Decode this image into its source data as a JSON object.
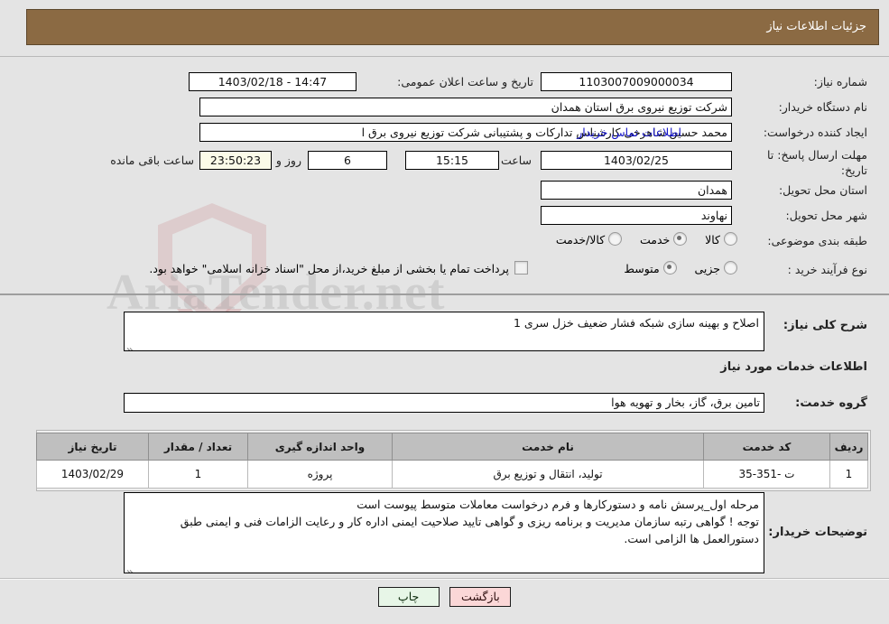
{
  "header": {
    "title": "جزئیات اطلاعات نیاز"
  },
  "details": {
    "need_number_label": "شماره نیاز:",
    "need_number_value": "1103007009000034",
    "announce_datetime_label": "تاریخ و ساعت اعلان عمومی:",
    "announce_datetime_value": "14:47 - 1403/02/18",
    "buyer_org_label": "نام دستگاه خریدار:",
    "buyer_org_value": "شرکت توزیع نیروی برق استان همدان",
    "creator_label": "ایجاد کننده درخواست:",
    "creator_value": "محمد حسین شاهرخی کارشناس تدارکات و پشتیبانی شرکت توزیع نیروی برق ا",
    "buyer_contact_link": "اطلاعات تماس خریدار",
    "deadline_label_line1": "مهلت ارسال پاسخ: تا",
    "deadline_label_line2": "تاریخ:",
    "deadline_date_value": "1403/02/25",
    "deadline_hour_label": "ساعت",
    "deadline_hour_value": "15:15",
    "remaining_days_value": "6",
    "remaining_days_label": "روز و",
    "remaining_time_value": "23:50:23",
    "remaining_suffix_label": "ساعت باقی مانده",
    "province_label": "استان محل تحویل:",
    "province_value": "همدان",
    "city_label": "شهر محل تحویل:",
    "city_value": "نهاوند",
    "category_label": "طبقه بندی موضوعی:",
    "category_options": [
      {
        "label": "کالا",
        "selected": false
      },
      {
        "label": "خدمت",
        "selected": true
      },
      {
        "label": "کالا/خدمت",
        "selected": false
      }
    ],
    "purchase_type_label": "نوع فرآیند خرید :",
    "purchase_type_options": [
      {
        "label": "جزیی",
        "selected": false
      },
      {
        "label": "متوسط",
        "selected": true
      }
    ],
    "treasury_checkbox_label": "پرداخت تمام یا بخشی از مبلغ خرید،از محل \"اسناد خزانه اسلامی\" خواهد بود.",
    "treasury_checkbox_checked": false
  },
  "summary": {
    "label": "شرح کلی نیاز:",
    "value": "اصلاح و بهینه سازی شبکه فشار ضعیف خزل سری 1"
  },
  "services": {
    "section_title": "اطلاعات خدمات مورد نیاز",
    "group_label": "گروه خدمت:",
    "group_value": "تامین برق، گاز، بخار و تهویه هوا",
    "columns": [
      "ردیف",
      "کد خدمت",
      "نام خدمت",
      "واحد اندازه گیری",
      "تعداد / مقدار",
      "تاریخ نیاز"
    ],
    "rows": [
      {
        "index": "1",
        "code": "ت -351-35",
        "name": "تولید، انتقال و توزیع برق",
        "unit": "پروژه",
        "quantity": "1",
        "need_date": "1403/02/29"
      }
    ]
  },
  "notes": {
    "label": "توضیحات خریدار:",
    "line1": "مرحله اول_پرسش نامه و دستورکارها و فرم درخواست معاملات متوسط پیوست است",
    "line2": "توجه ! گواهی رتبه سازمان مدیریت و برنامه ریزی و گواهی تایید صلاحیت ایمنی اداره کار و رعایت الزامات فنی و ایمنی طبق",
    "line3": "دستورالعمل ها الزامی است."
  },
  "footer": {
    "print_label": "چاپ",
    "back_label": "بازگشت"
  },
  "watermark": {
    "text": "AriaTender.net"
  },
  "colors": {
    "header_bg": "#8b6a43",
    "page_bg": "#e4e4e4",
    "link": "#1414c8",
    "print_btn": "#e7f6e7",
    "back_btn": "#fbd7d7",
    "timer_bg": "#fbfbe8",
    "table_header_bg": "#bfbfbf"
  }
}
